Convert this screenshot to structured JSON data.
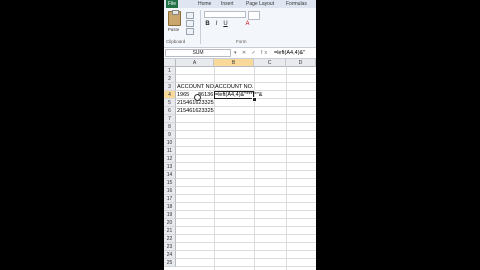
{
  "ribbon": {
    "tabs": [
      "File",
      "Home",
      "Insert",
      "Page Layout",
      "Formulas"
    ],
    "paste_label": "Paste",
    "font_name": "",
    "format_buttons": [
      "B",
      "I",
      "U",
      "A"
    ],
    "groups": {
      "clipboard": "Clipboard",
      "font": "Form"
    }
  },
  "formula_bar": {
    "name_box": "SUM",
    "icons": "▾ ✕ ✓ fx",
    "formula": "=left(A4,4)&\""
  },
  "sheet": {
    "columns": [
      "A",
      "B",
      "C",
      "D"
    ],
    "rows": [
      "1",
      "2",
      "3",
      "4",
      "5",
      "6",
      "7",
      "8",
      "9",
      "10",
      "11",
      "12",
      "13",
      "14",
      "15",
      "16",
      "17",
      "18",
      "19",
      "20",
      "21",
      "22",
      "23",
      "24",
      "25"
    ],
    "cells": {
      "A3": "ACCOUNT NO.",
      "B3": "ACCOUNT NO.",
      "A4": "1965",
      "A4b": "86136",
      "B4": "=left(A4,4)&\"*****\"&",
      "A5": "215461623325",
      "A6": "215461623325"
    },
    "selected_column": "B",
    "selected_row": "4"
  }
}
